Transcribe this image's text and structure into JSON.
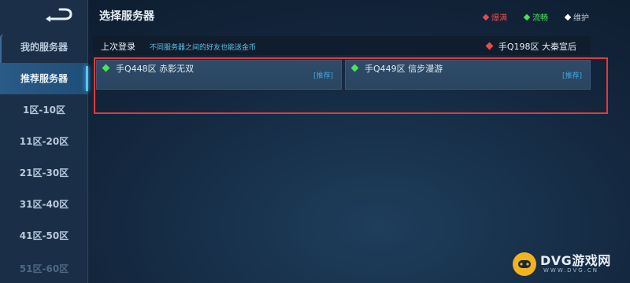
{
  "header": {
    "title": "选择服务器"
  },
  "legend": [
    {
      "label": "爆满",
      "color": "#e84a4a"
    },
    {
      "label": "流畅",
      "color": "#4de05c"
    },
    {
      "label": "维护",
      "color": "#ffffff"
    }
  ],
  "sidebar": {
    "back_icon": "back-arrow-icon",
    "items": [
      {
        "label": "我的服务器"
      },
      {
        "label": "推荐服务器",
        "active": true
      },
      {
        "label": "1区-10区"
      },
      {
        "label": "11区-20区"
      },
      {
        "label": "21区-30区"
      },
      {
        "label": "31区-40区"
      },
      {
        "label": "41区-50区"
      },
      {
        "label": "51区-60区"
      }
    ]
  },
  "last_login": {
    "label": "上次登录",
    "note": "不同服务器之间的好友也能送金币",
    "server": "手Q198区 大秦宣后",
    "status_color": "#e84a4a"
  },
  "servers": [
    {
      "name": "手Q448区 赤影无双",
      "tag": "[推荐]",
      "status_color": "#4de05c"
    },
    {
      "name": "手Q449区 信步漫游",
      "tag": "[推荐]",
      "status_color": "#4de05c"
    }
  ],
  "watermark": {
    "title": "DVG游戏网",
    "url": "WWW.DVG.CN"
  }
}
